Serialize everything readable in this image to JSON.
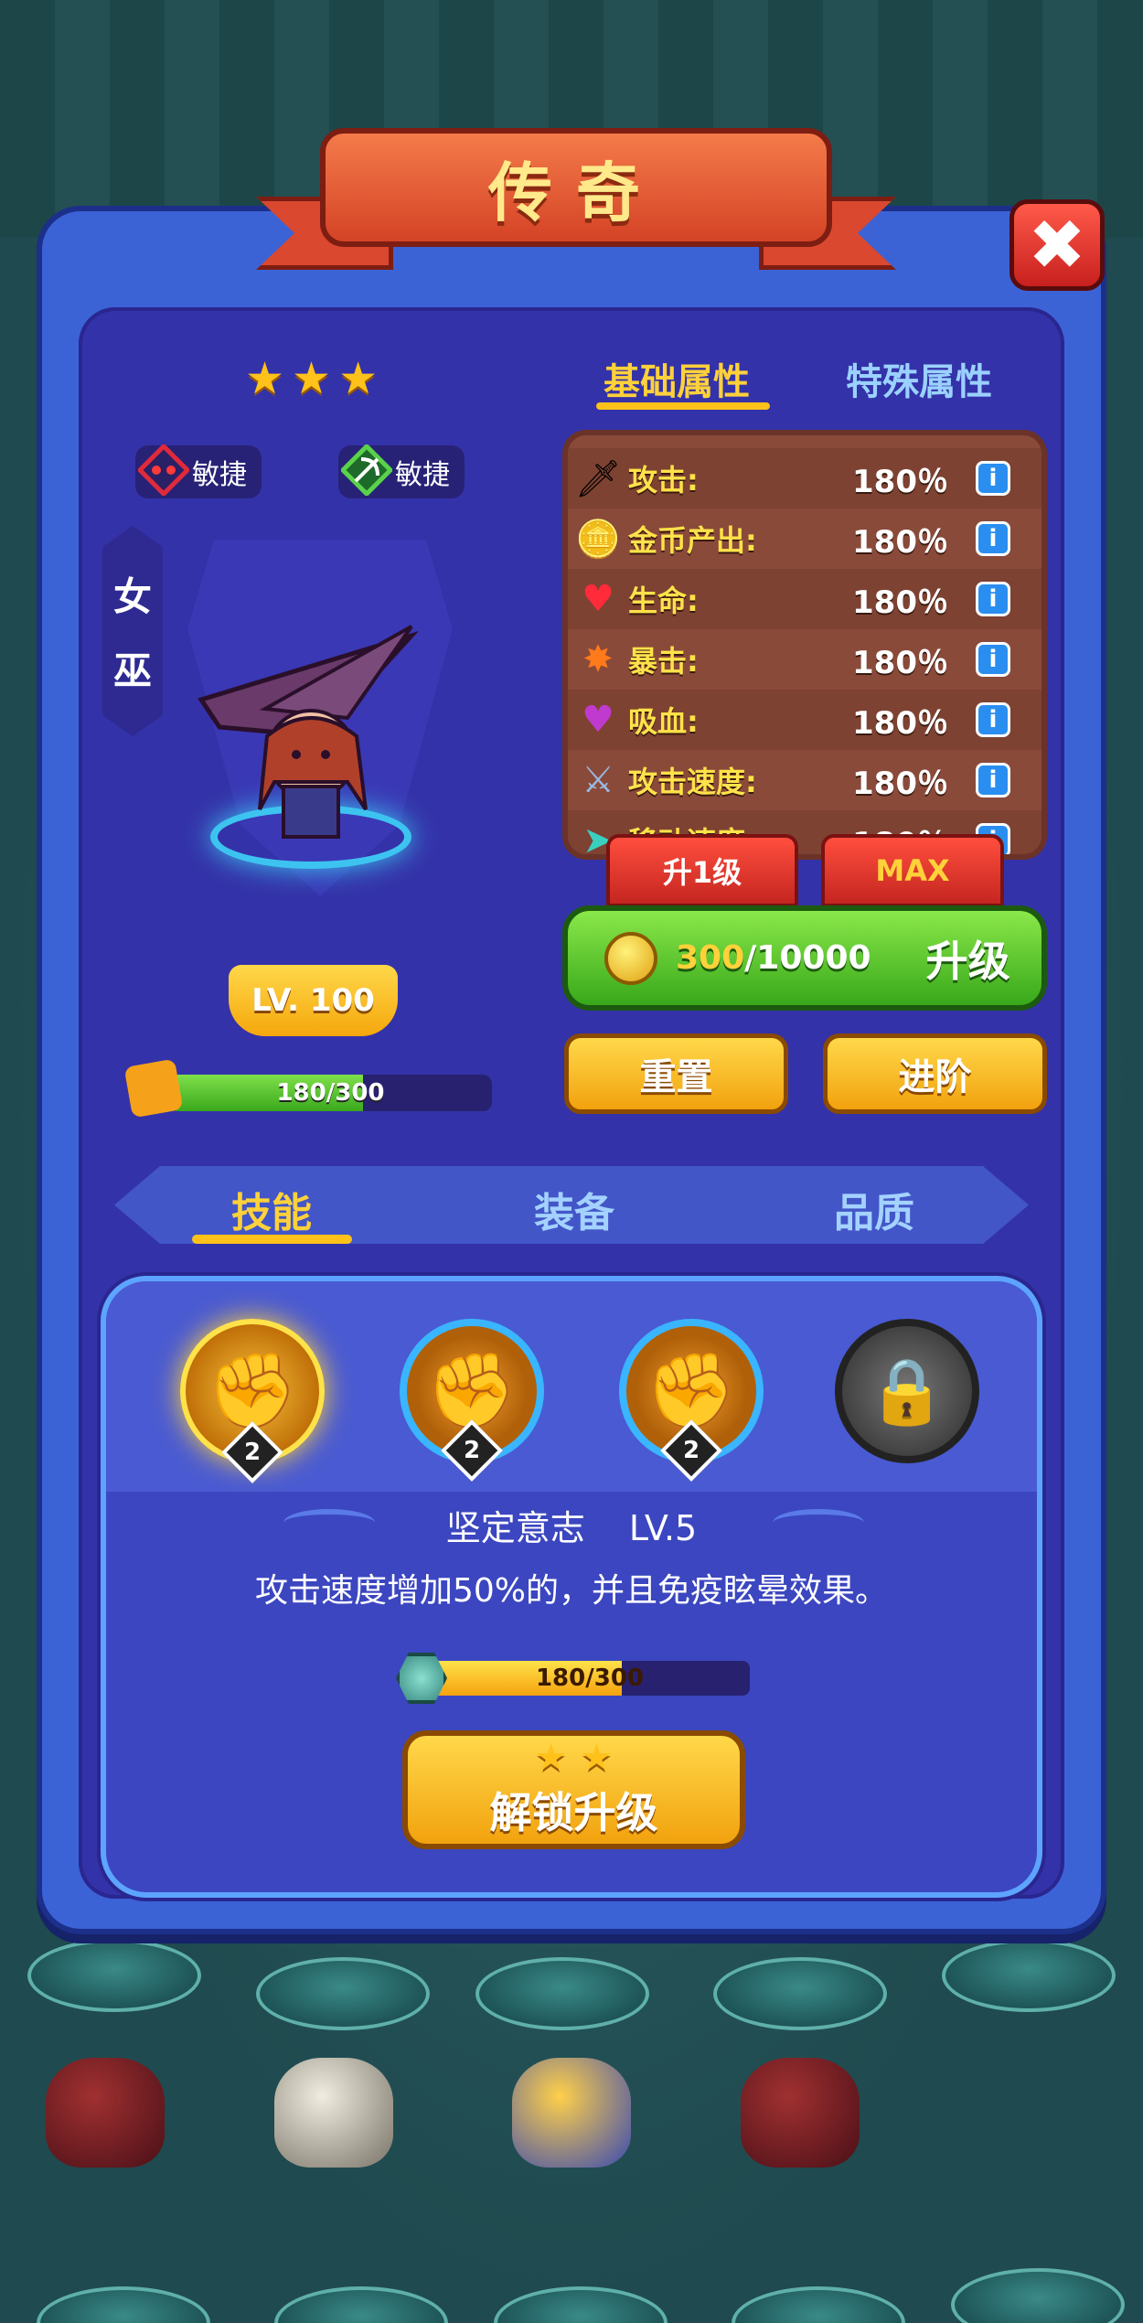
{
  "rarity_title": "传奇",
  "close_symbol": "✖",
  "hero": {
    "stars": 3,
    "name_chars": [
      "女",
      "巫"
    ],
    "level": "LV. 100",
    "tags": [
      {
        "icon": "demon-mask-icon",
        "label": "敏捷"
      },
      {
        "icon": "bow-icon",
        "label": "敏捷"
      }
    ],
    "fragments": {
      "current": 180,
      "max": 300,
      "text": "180/300"
    }
  },
  "attribute_tabs": {
    "basic": "基础属性",
    "special": "特殊属性",
    "active": "basic"
  },
  "stats": [
    {
      "icon": "sword-icon",
      "label": "攻击:",
      "value": "180％"
    },
    {
      "icon": "gold-coins-icon",
      "label": "金币产出:",
      "value": "180％"
    },
    {
      "icon": "heart-icon",
      "label": "生命:",
      "value": "180％"
    },
    {
      "icon": "crit-icon",
      "label": "暴击:",
      "value": "180％"
    },
    {
      "icon": "lifesteal-icon",
      "label": "吸血:",
      "value": "180％"
    },
    {
      "icon": "attack-speed-icon",
      "label": "攻击速度:",
      "value": "180％"
    },
    {
      "icon": "move-speed-icon",
      "label": "移动速度:",
      "value": "180％"
    }
  ],
  "info_symbol": "i",
  "level_tabs": {
    "one": "升1级",
    "max": "MAX"
  },
  "upgrade": {
    "cost_current": "300",
    "cost_total": "/10000",
    "label": "升级"
  },
  "buttons": {
    "reset": "重置",
    "advance": "进阶"
  },
  "bottom_tabs": {
    "skills": "技能",
    "equipment": "装备",
    "quality": "品质",
    "active": "skills"
  },
  "skills": [
    {
      "icon": "fist-icon",
      "level": "2",
      "state": "selected"
    },
    {
      "icon": "fist-icon",
      "level": "2",
      "state": "unlocked"
    },
    {
      "icon": "fist-icon",
      "level": "2",
      "state": "unlocked"
    },
    {
      "icon": "lock-icon",
      "level": "",
      "state": "locked"
    }
  ],
  "selected_skill": {
    "name": "坚定意志",
    "level": "LV.5",
    "description": "攻击速度增加50%的，并且免疫眩晕效果。",
    "progress": {
      "current": 180,
      "max": 300,
      "text": "180/300"
    }
  },
  "unlock_button": {
    "stars": 2,
    "label": "解锁升级"
  },
  "colors": {
    "panel": "#3b63d6",
    "panel_inner": "#3432a8",
    "gold": "#ffd13a",
    "stat_label": "#ffe24a",
    "green_button": "#38a81a",
    "ribbon": "#d44326"
  }
}
